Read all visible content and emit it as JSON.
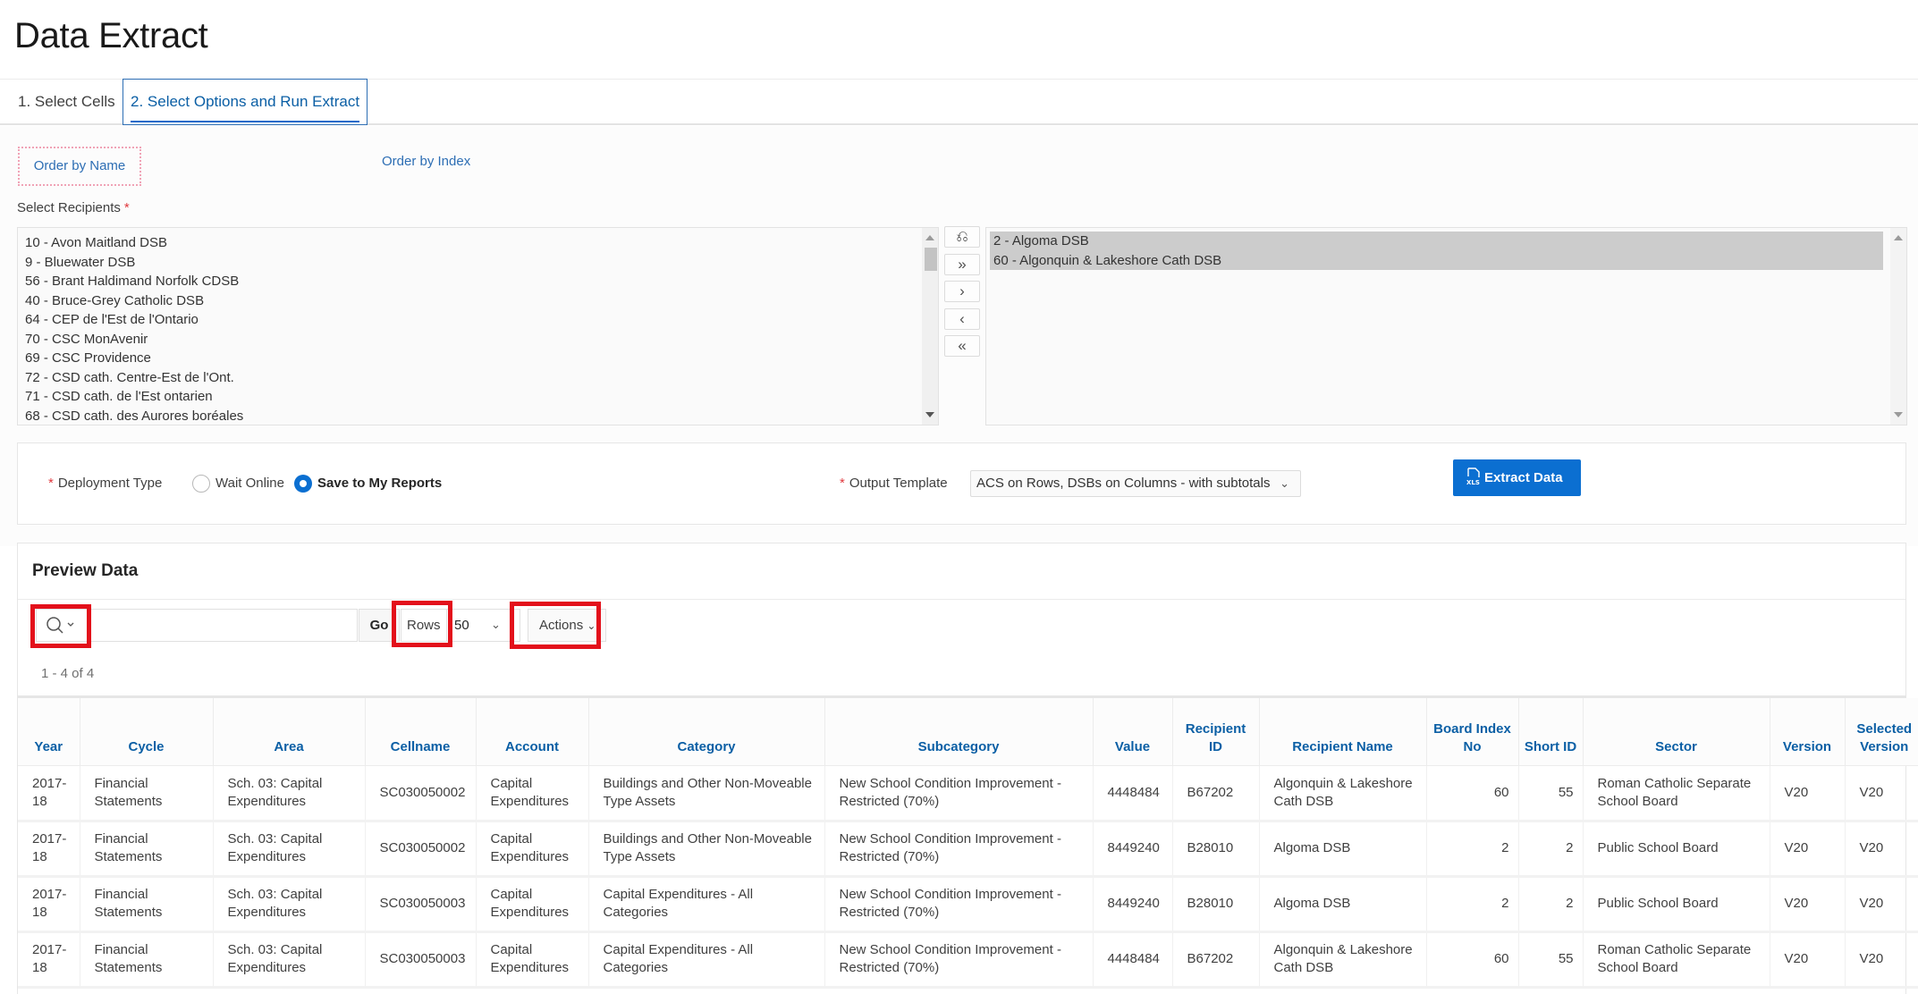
{
  "page": {
    "title": "Data Extract"
  },
  "tabs": [
    {
      "label": "1. Select Cells",
      "active": false
    },
    {
      "label": "2. Select Options and Run Extract",
      "active": true
    }
  ],
  "ordering": {
    "by_name": "Order by Name",
    "by_index": "Order by Index"
  },
  "recipients": {
    "label": "Select Recipients",
    "required_marker": "*",
    "available": [
      "10 - Avon Maitland DSB",
      "9 - Bluewater DSB",
      "56 - Brant Haldimand Norfolk CDSB",
      "40 - Bruce-Grey Catholic DSB",
      "64 - CEP de l'Est de l'Ontario",
      "70 - CSC MonAvenir",
      "69 - CSC Providence",
      "72 - CSD cath. Centre-Est de l'Ont.",
      "71 - CSD cath. de l'Est ontarien",
      "68 - CSD cath. des Aurores boréales"
    ],
    "selected": [
      "2 - Algoma DSB",
      "60 - Algonquin & Lakeshore Cath DSB"
    ],
    "shuttle_buttons": [
      {
        "name": "reset",
        "glyph": "⎌"
      },
      {
        "name": "move-all",
        "glyph": "»"
      },
      {
        "name": "move",
        "glyph": "›"
      },
      {
        "name": "remove",
        "glyph": "‹"
      },
      {
        "name": "remove-all",
        "glyph": "«"
      }
    ]
  },
  "options": {
    "deployment_label": "Deployment Type",
    "deployment_options": [
      {
        "label": "Wait Online",
        "selected": false
      },
      {
        "label": "Save to My Reports",
        "selected": true
      }
    ],
    "template_label": "Output Template",
    "template_value": "ACS on Rows, DSBs on Columns - with subtotals",
    "extract_button": "Extract Data",
    "required_marker": "*",
    "chevron": "⌄"
  },
  "preview": {
    "title": "Preview Data",
    "search_value": "",
    "go_label": "Go",
    "rows_label": "Rows",
    "rows_value": "50",
    "actions_label": "Actions",
    "pagination": "1 - 4 of 4",
    "columns": [
      "Year",
      "Cycle",
      "Area",
      "Cellname",
      "Account",
      "Category",
      "Subcategory",
      "Value",
      "Recipient ID",
      "Recipient Name",
      "Board Index No",
      "Short ID",
      "Sector",
      "Version",
      "Selected Version"
    ],
    "rows": [
      [
        "2017-18",
        "Financial Statements",
        "Sch. 03: Capital Expenditures",
        "SC030050002",
        "Capital Expenditures",
        "Buildings and Other Non-Moveable Type Assets",
        "New School Condition Improvement - Restricted (70%)",
        "4448484",
        "B67202",
        "Algonquin & Lakeshore Cath DSB",
        "60",
        "55",
        "Roman Catholic Separate School Board",
        "V20",
        "V20"
      ],
      [
        "2017-18",
        "Financial Statements",
        "Sch. 03: Capital Expenditures",
        "SC030050002",
        "Capital Expenditures",
        "Buildings and Other Non-Moveable Type Assets",
        "New School Condition Improvement - Restricted (70%)",
        "8449240",
        "B28010",
        "Algoma DSB",
        "2",
        "2",
        "Public School Board",
        "V20",
        "V20"
      ],
      [
        "2017-18",
        "Financial Statements",
        "Sch. 03: Capital Expenditures",
        "SC030050003",
        "Capital Expenditures",
        "Capital Expenditures - All Categories",
        "New School Condition Improvement - Restricted (70%)",
        "8449240",
        "B28010",
        "Algoma DSB",
        "2",
        "2",
        "Public School Board",
        "V20",
        "V20"
      ],
      [
        "2017-18",
        "Financial Statements",
        "Sch. 03: Capital Expenditures",
        "SC030050003",
        "Capital Expenditures",
        "Capital Expenditures - All Categories",
        "New School Condition Improvement - Restricted (70%)",
        "4448484",
        "B67202",
        "Algonquin & Lakeshore Cath DSB",
        "60",
        "55",
        "Roman Catholic Separate School Board",
        "V20",
        "V20"
      ]
    ]
  },
  "colors": {
    "accent": "#0b6fd1",
    "link": "#2d6eb4",
    "highlight": "#e3101b",
    "required": "#e0393e"
  }
}
